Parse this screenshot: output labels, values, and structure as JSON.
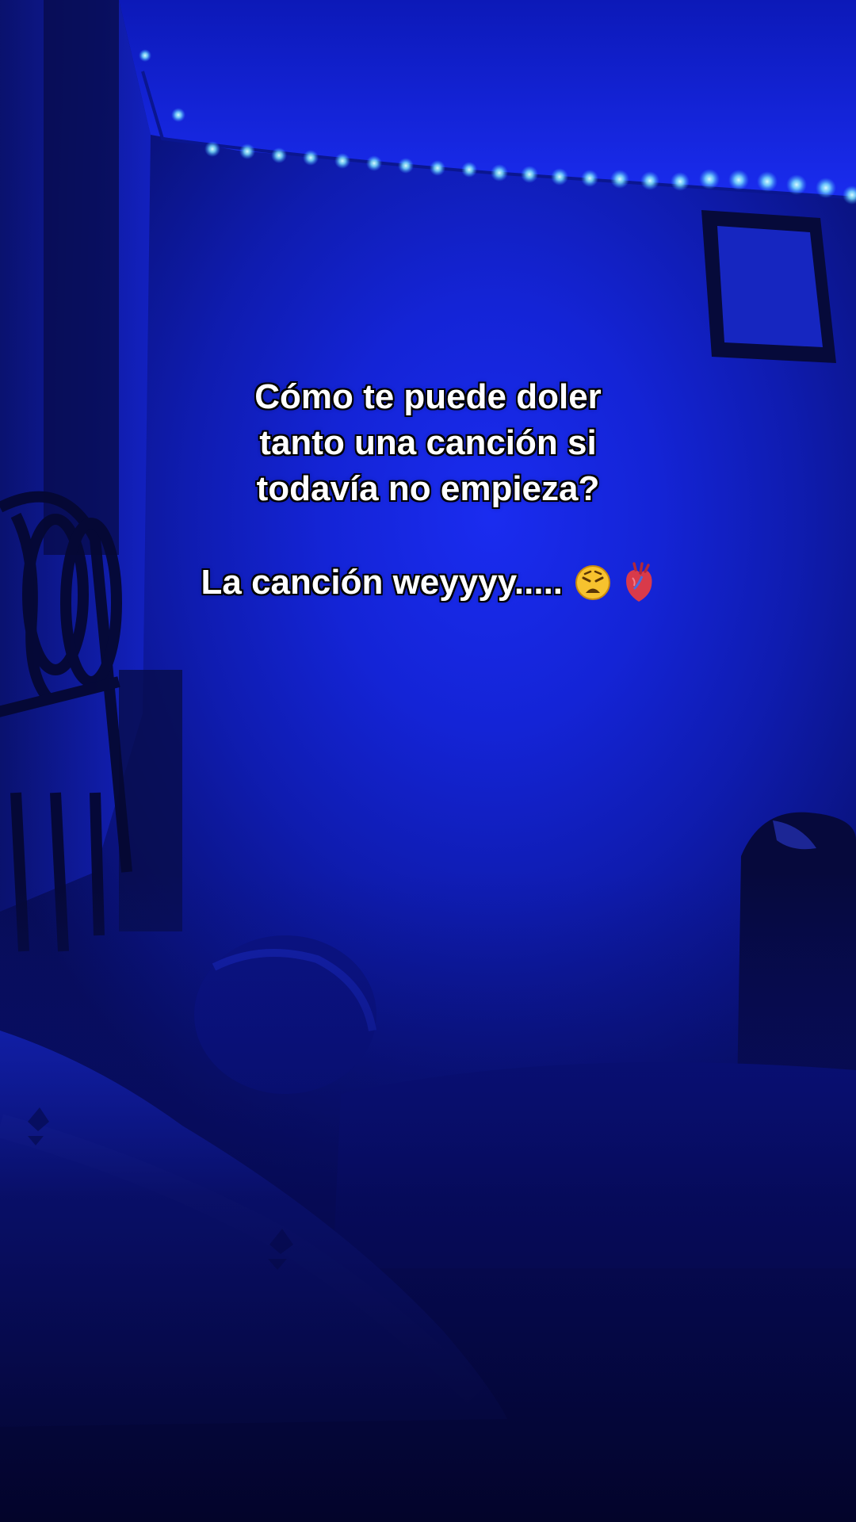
{
  "overlay": {
    "line1": "Cómo te puede doler",
    "line2": "tanto una canción si",
    "line3": "todavía no empieza?",
    "line4": "La canción weyyyy.....",
    "emojis": [
      "weary-face-emoji",
      "anatomical-heart-emoji"
    ]
  },
  "colors": {
    "wall_blue": "#1424d6",
    "led_cyan": "#7fe8ff",
    "shadow_navy": "#05063a",
    "text_white": "#ffffff"
  }
}
